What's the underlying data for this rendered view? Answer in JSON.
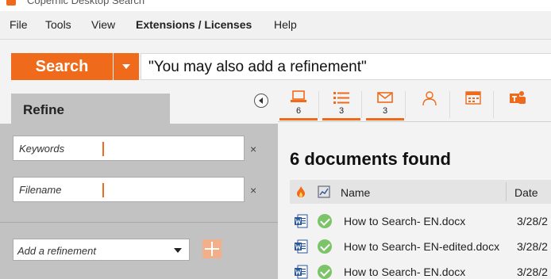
{
  "window": {
    "title": "Copernic Desktop Search"
  },
  "menu": [
    {
      "label": "File",
      "bold": false
    },
    {
      "label": "Tools",
      "bold": false
    },
    {
      "label": "View",
      "bold": false
    },
    {
      "label": "Extensions / Licenses",
      "bold": true
    },
    {
      "label": "Help",
      "bold": false
    }
  ],
  "search": {
    "button_label": "Search",
    "query": "\"You may also add a refinement\""
  },
  "refine": {
    "title": "Refine",
    "fields": [
      {
        "label": "Keywords",
        "value": ""
      },
      {
        "label": "Filename",
        "value": ""
      }
    ],
    "clear_symbol": "×",
    "add_refinement": "Add a refinement"
  },
  "categories": [
    {
      "icon": "computer-icon",
      "count": "6",
      "active": true
    },
    {
      "icon": "list-icon",
      "count": "3",
      "active": true
    },
    {
      "icon": "email-icon",
      "count": "3",
      "active": true
    },
    {
      "icon": "contact-icon",
      "count": "",
      "active": false
    },
    {
      "icon": "calendar-icon",
      "count": "",
      "active": false
    },
    {
      "icon": "teams-icon",
      "count": "",
      "active": false
    }
  ],
  "results": {
    "summary": "6 documents found",
    "columns": {
      "name": "Name",
      "date": "Date"
    },
    "rows": [
      {
        "name": "How to Search- EN.docx",
        "date": "3/28/2"
      },
      {
        "name": "How to Search- EN-edited.docx",
        "date": "3/28/2"
      },
      {
        "name": "How to Search- EN.docx",
        "date": "3/28/2"
      }
    ]
  },
  "colors": {
    "accent": "#ef6a1a",
    "panel": "#c2c2c2",
    "check": "#7cc36a",
    "word_blue": "#2b5797"
  }
}
